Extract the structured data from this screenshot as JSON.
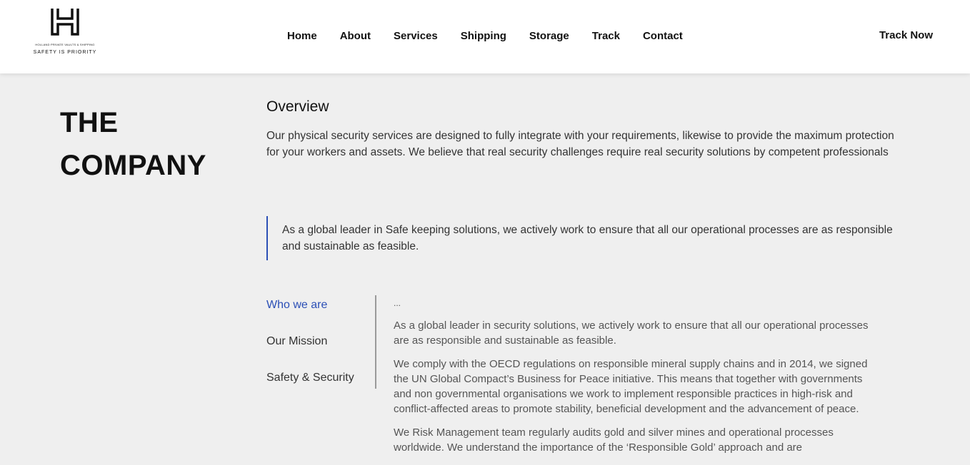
{
  "logo": {
    "tagline_small": "HOLLAND PRIVATE VAULTS & SHIPPING",
    "tagline": "SAFETY IS PRIORITY"
  },
  "nav": {
    "items": [
      "Home",
      "About",
      "Services",
      "Shipping",
      "Storage",
      "Track",
      "Contact"
    ],
    "cta": "Track Now"
  },
  "page": {
    "title_line1": "THE",
    "title_line2": "COMPANY",
    "overview_heading": "Overview",
    "overview_text": "Our physical security services are designed to fully integrate with your requirements, likewise to provide the maximum protection for your workers and assets. We believe that real security challenges require real security solutions by competent professionals",
    "quote": "As a global leader in Safe keeping solutions, we actively work to ensure that all our operational processes are as responsible and sustainable as feasible."
  },
  "tabs": {
    "items": [
      "Who we are",
      "Our Mission",
      "Safety & Security"
    ],
    "active_index": 0,
    "content": {
      "dots": "...",
      "paragraphs": [
        "As a global leader in security solutions, we actively work to ensure that all our operational processes are as responsible and sustainable as feasible.",
        "We comply with the OECD regulations on responsible mineral supply chains and in 2014, we signed the UN Global Compact’s Business for Peace initiative. This means that together with governments and non governmental organisations we work to implement responsible practices in high-risk and conflict-affected areas to promote stability, beneficial development and the advancement of peace.",
        "We Risk Management team regularly audits gold and silver mines and operational processes worldwide. We understand the importance of the ‘Responsible Gold’ approach and are"
      ]
    }
  },
  "colors": {
    "accent": "#2b4fb6",
    "background": "#efefef",
    "header": "#ffffff"
  }
}
